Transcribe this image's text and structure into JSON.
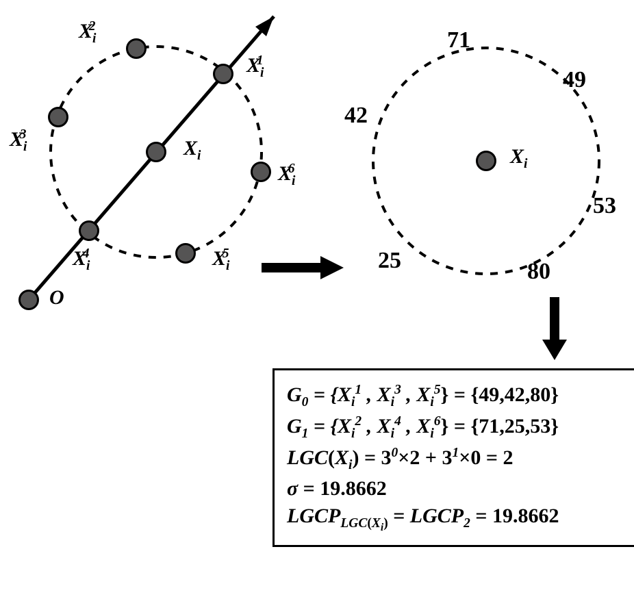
{
  "chart_data": {
    "type": "diagram",
    "title": "",
    "left": {
      "origin_label": "O",
      "center": {
        "name": "X_i"
      },
      "neighbors": [
        {
          "name": "X_i^1"
        },
        {
          "name": "X_i^2"
        },
        {
          "name": "X_i^3"
        },
        {
          "name": "X_i^4"
        },
        {
          "name": "X_i^5"
        },
        {
          "name": "X_i^6"
        }
      ]
    },
    "right": {
      "center_name": "X_i",
      "values": [
        71,
        49,
        42,
        53,
        25,
        80
      ]
    }
  },
  "labels": {
    "O": "O",
    "Xi": "X",
    "Xi_sub": "i",
    "X1": "X",
    "X1_sup": "1",
    "X2": "X",
    "X2_sup": "2",
    "X3": "X",
    "X3_sup": "3",
    "X4": "X",
    "X4_sup": "4",
    "X5": "X",
    "X5_sup": "5",
    "X6": "X",
    "X6_sup": "6",
    "sub_i": "i"
  },
  "vals": {
    "v71": "71",
    "v49": "49",
    "v42": "42",
    "v53": "53",
    "v25": "25",
    "v80": "80"
  },
  "eq": {
    "g0_lhs": "G",
    "g0_sub": "0",
    "g0_set": " = {",
    "g0_x1": "X",
    "g0_x1_sup": "1",
    "g0_x3": "X",
    "g0_x3_sup": "3",
    "g0_x5": "X",
    "g0_x5_sup": "5",
    "g0_rhs": "} = {49,42,80}",
    "g1_lhs": "G",
    "g1_sub": "1",
    "g1_x2": "X",
    "g1_x2_sup": "2",
    "g1_x4": "X",
    "g1_x4_sup": "4",
    "g1_x6": "X",
    "g1_x6_sup": "6",
    "g1_rhs": "} = {71,25,53}",
    "lgc_lhs": "LGC",
    "lgc_arg_open": "(",
    "lgc_arg": "X",
    "lgc_arg_close": ")",
    "lgc_eq": " = 3",
    "lgc_e0": "0",
    "lgc_t2": "×2 + 3",
    "lgc_e1": "1",
    "lgc_t0": "×0 = 2",
    "sigma": "σ",
    "sigma_val": " = 19.8662",
    "lgc_p": "LGCP",
    "lgc_p_sub1a": "LGC",
    "lgc_p_sub1_open": "(",
    "lgc_p_sub1_x": "X",
    "lgc_p_sub1_i": "i",
    "lgc_p_sub1_close": ")",
    "lgc_p_eq1": " = ",
    "lgc_p2": "LGCP",
    "lgc_p_sub2": "2",
    "lgc_p_val": " = 19.8662",
    "comma": " , "
  }
}
